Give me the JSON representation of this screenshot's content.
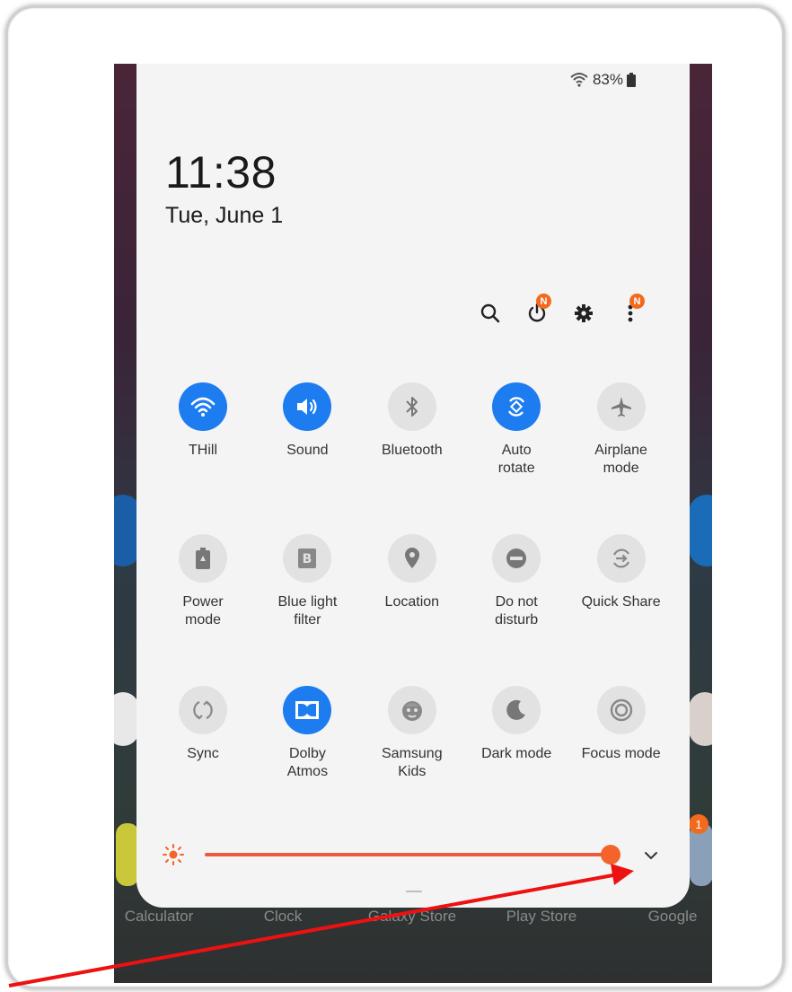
{
  "status": {
    "battery": "83%"
  },
  "clock": {
    "time": "11:38",
    "date": "Tue, June 1"
  },
  "top_actions": {
    "power_badge": "N",
    "more_badge": "N"
  },
  "tiles": [
    {
      "label": "THill",
      "icon": "wifi-icon",
      "on": true
    },
    {
      "label": "Sound",
      "icon": "speaker-icon",
      "on": true
    },
    {
      "label": "Bluetooth",
      "icon": "bluetooth-icon",
      "on": false
    },
    {
      "label": "Auto\nrotate",
      "icon": "auto-rotate-icon",
      "on": true
    },
    {
      "label": "Airplane\nmode",
      "icon": "airplane-icon",
      "on": false
    },
    {
      "label": "Power\nmode",
      "icon": "battery-icon",
      "on": false
    },
    {
      "label": "Blue light\nfilter",
      "icon": "blue-light-icon",
      "on": false
    },
    {
      "label": "Location",
      "icon": "location-icon",
      "on": false
    },
    {
      "label": "Do not\ndisturb",
      "icon": "dnd-icon",
      "on": false
    },
    {
      "label": "Quick Share",
      "icon": "quick-share-icon",
      "on": false
    },
    {
      "label": "Sync",
      "icon": "sync-icon",
      "on": false
    },
    {
      "label": "Dolby\nAtmos",
      "icon": "dolby-icon",
      "on": true
    },
    {
      "label": "Samsung\nKids",
      "icon": "kids-icon",
      "on": false
    },
    {
      "label": "Dark mode",
      "icon": "moon-icon",
      "on": false
    },
    {
      "label": "Focus mode",
      "icon": "focus-icon",
      "on": false
    }
  ],
  "brightness": {
    "level": 0.97
  },
  "dock": {
    "apps": [
      "Calculator",
      "Clock",
      "Galaxy Store",
      "Play Store",
      "Google"
    ],
    "google_badge": "1"
  },
  "colors": {
    "accent": "#1c7cf0",
    "brightness": "#ea5a3b",
    "badge": "#f16a1d",
    "annotation_arrow": "#ee1111"
  }
}
